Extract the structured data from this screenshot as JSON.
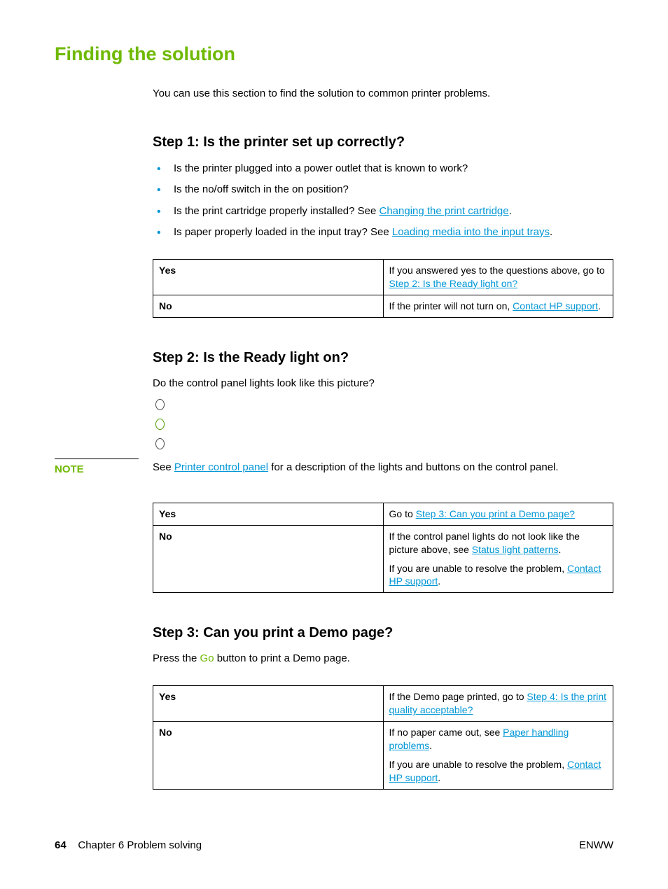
{
  "title": "Finding the solution",
  "intro": "You can use this section to find the solution to common printer problems.",
  "step1": {
    "heading": "Step 1: Is the printer set up correctly?",
    "bullets": [
      {
        "text": "Is the printer plugged into a power outlet that is known to work?"
      },
      {
        "text": "Is the no/off switch in the on position?"
      },
      {
        "pre": "Is the print cartridge properly installed? See ",
        "link": "Changing the print cartridge",
        "post": "."
      },
      {
        "pre": "Is paper properly loaded in the input tray? See ",
        "link": "Loading media into the input trays",
        "post": "."
      }
    ],
    "table": {
      "yes_label": "Yes",
      "yes_pre": "If you answered yes to the questions above, go to ",
      "yes_link": "Step 2: Is the Ready light on?",
      "no_label": "No",
      "no_pre": "If the printer will not turn on, ",
      "no_link": "Contact HP support",
      "no_post": "."
    }
  },
  "step2": {
    "heading": "Step 2: Is the Ready light on?",
    "question": "Do the control panel lights look like this picture?",
    "note_label": "NOTE",
    "note_pre": "See ",
    "note_link": "Printer control panel",
    "note_post": " for a description of the lights and buttons on the control panel.",
    "table": {
      "yes_label": "Yes",
      "yes_pre": "Go to ",
      "yes_link": "Step 3: Can you print a Demo page?",
      "no_label": "No",
      "no_p1_pre": "If the control panel lights do not look like the picture above, see ",
      "no_p1_link": "Status light patterns",
      "no_p1_post": ".",
      "no_p2_pre": "If you are unable to resolve the problem, ",
      "no_p2_link": "Contact HP support",
      "no_p2_post": "."
    }
  },
  "step3": {
    "heading": "Step 3: Can you print a Demo page?",
    "press_pre": "Press the ",
    "press_go": "Go",
    "press_post": " button to print a Demo page.",
    "table": {
      "yes_label": "Yes",
      "yes_pre": "If the Demo page printed, go to ",
      "yes_link": "Step 4: Is the print quality acceptable?",
      "no_label": "No",
      "no_p1_pre": "If no paper came out, see ",
      "no_p1_link": "Paper handling problems",
      "no_p1_post": ".",
      "no_p2_pre": "If you are unable to resolve the problem, ",
      "no_p2_link": "Contact HP support",
      "no_p2_post": "."
    }
  },
  "footer": {
    "page_number": "64",
    "chapter": "Chapter 6  Problem solving",
    "right": "ENWW"
  }
}
